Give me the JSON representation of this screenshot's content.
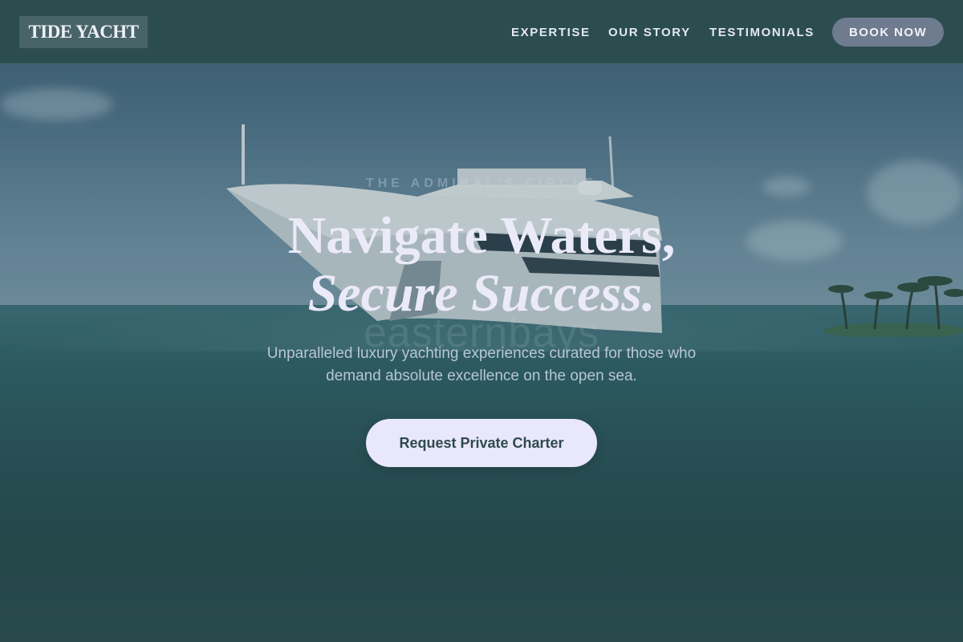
{
  "header": {
    "logo": "TIDE YACHT",
    "nav": [
      {
        "label": "EXPERTISE"
      },
      {
        "label": "OUR STORY"
      },
      {
        "label": "TESTIMONIALS"
      }
    ],
    "book_button": "BOOK NOW"
  },
  "hero": {
    "eyebrow": "THE ADMIRAL'S CIRCLE",
    "headline_line1": "Navigate Waters,",
    "headline_line2": "Secure Success.",
    "watermark": "easternbays",
    "subtitle_line1": "Unparalleled luxury yachting experiences curated for those who",
    "subtitle_line2": "demand absolute excellence on the open sea.",
    "cta": "Request Private Charter",
    "background_image": "yacht-at-sea-photo"
  },
  "colors": {
    "header_bg": "#2c4c4e",
    "book_button_bg": "#6f7b8f",
    "cta_bg": "#e9e7fb",
    "cta_text": "#2f4a4e",
    "headline": "#ebeaf8"
  }
}
